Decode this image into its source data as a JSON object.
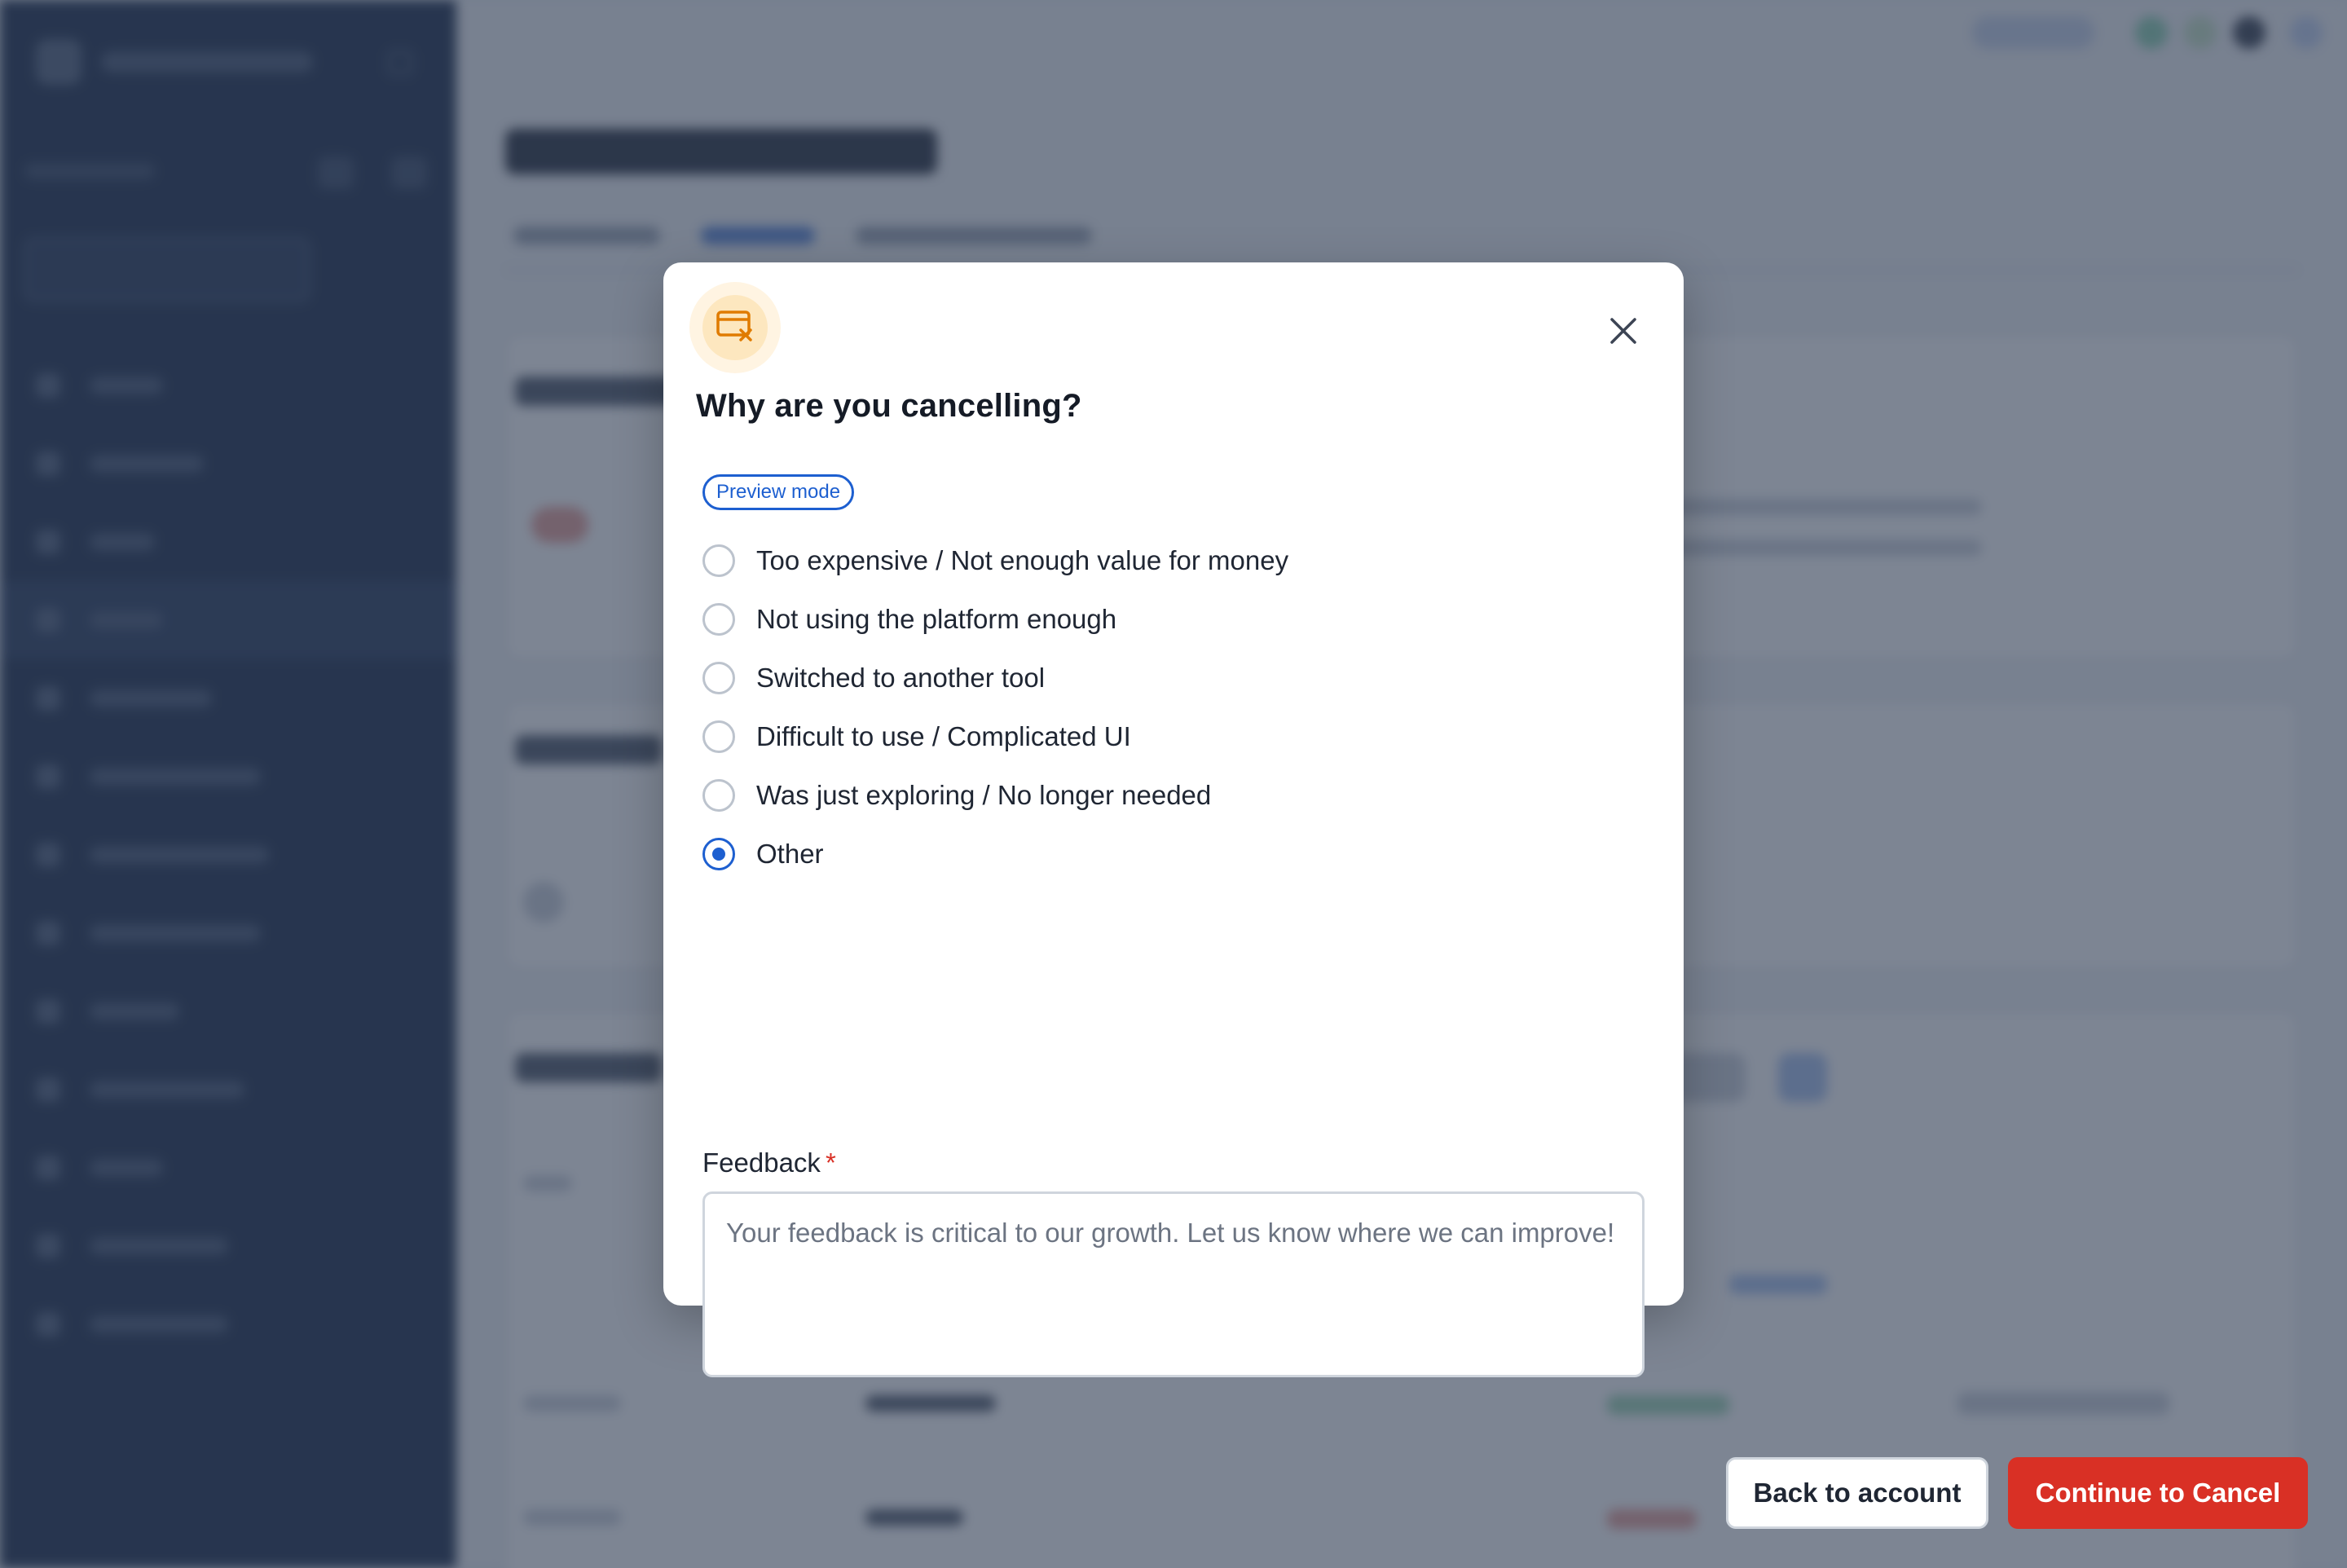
{
  "background": {
    "note_hidden_blurred": true
  },
  "modal": {
    "icon": "credit-card-cancel-icon",
    "title": "Why are you cancelling?",
    "badge": "Preview mode",
    "options": [
      {
        "label": "Too expensive / Not enough value for money",
        "checked": false
      },
      {
        "label": "Not using the platform enough",
        "checked": false
      },
      {
        "label": "Switched to another tool",
        "checked": false
      },
      {
        "label": "Difficult to use / Complicated UI",
        "checked": false
      },
      {
        "label": "Was just exploring / No longer needed",
        "checked": false
      },
      {
        "label": "Other",
        "checked": true
      }
    ],
    "feedback": {
      "label": "Feedback",
      "required_marker": "*",
      "placeholder": "Your feedback is critical to our growth. Let us know where we can improve!",
      "value": ""
    },
    "buttons": {
      "back": "Back to account",
      "continue": "Continue to Cancel"
    }
  },
  "colors": {
    "primary": "#1d5fd0",
    "danger": "#d93025",
    "icon_bg": "#fde7bf",
    "icon_stroke": "#e07b00",
    "overlay": "#2d3a50"
  }
}
